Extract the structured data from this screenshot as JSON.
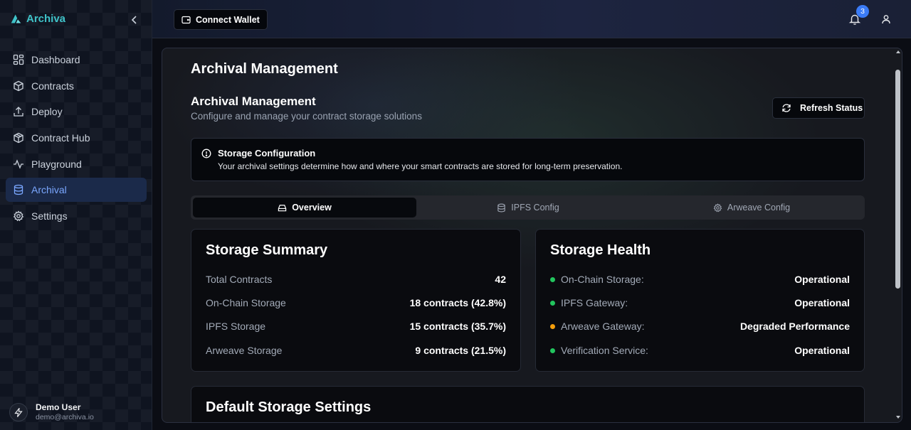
{
  "brand": {
    "name": "Archiva",
    "accent": "#3fc3c9"
  },
  "sidebar": {
    "collapse_icon": "chevron-left-icon",
    "items": [
      {
        "label": "Dashboard",
        "icon": "dashboard-icon"
      },
      {
        "label": "Contracts",
        "icon": "cube-icon"
      },
      {
        "label": "Deploy",
        "icon": "upload-icon"
      },
      {
        "label": "Contract Hub",
        "icon": "package-icon"
      },
      {
        "label": "Playground",
        "icon": "activity-icon"
      },
      {
        "label": "Archival",
        "icon": "database-icon",
        "active": true
      },
      {
        "label": "Settings",
        "icon": "gear-icon"
      }
    ],
    "user": {
      "name": "Demo User",
      "email": "demo@archiva.io"
    }
  },
  "topbar": {
    "wallet_label": "Connect Wallet",
    "notification_count": "3"
  },
  "main": {
    "page_title": "Archival Management",
    "section_title": "Archival Management",
    "section_subtitle": "Configure and manage your contract storage solutions",
    "refresh_label": "Refresh Status",
    "alert": {
      "title": "Storage Configuration",
      "text": "Your archival settings determine how and where your smart contracts are stored for long-term preservation."
    },
    "tabs": [
      {
        "label": "Overview",
        "icon": "hard-drive-icon",
        "active": true
      },
      {
        "label": "IPFS Config",
        "icon": "database-icon"
      },
      {
        "label": "Arweave Config",
        "icon": "gear-icon"
      }
    ],
    "summary": {
      "title": "Storage Summary",
      "rows": [
        {
          "label": "Total Contracts",
          "value": "42"
        },
        {
          "label": "On-Chain Storage",
          "value": "18 contracts (42.8%)"
        },
        {
          "label": "IPFS Storage",
          "value": "15 contracts (35.7%)"
        },
        {
          "label": "Arweave Storage",
          "value": "9 contracts (21.5%)"
        }
      ]
    },
    "health": {
      "title": "Storage Health",
      "rows": [
        {
          "label": "On-Chain Storage:",
          "value": "Operational",
          "color": "#22c55e"
        },
        {
          "label": "IPFS Gateway:",
          "value": "Operational",
          "color": "#22c55e"
        },
        {
          "label": "Arweave Gateway:",
          "value": "Degraded Performance",
          "color": "#f59e0b"
        },
        {
          "label": "Verification Service:",
          "value": "Operational",
          "color": "#22c55e"
        }
      ]
    },
    "defaults": {
      "title": "Default Storage Settings"
    }
  }
}
